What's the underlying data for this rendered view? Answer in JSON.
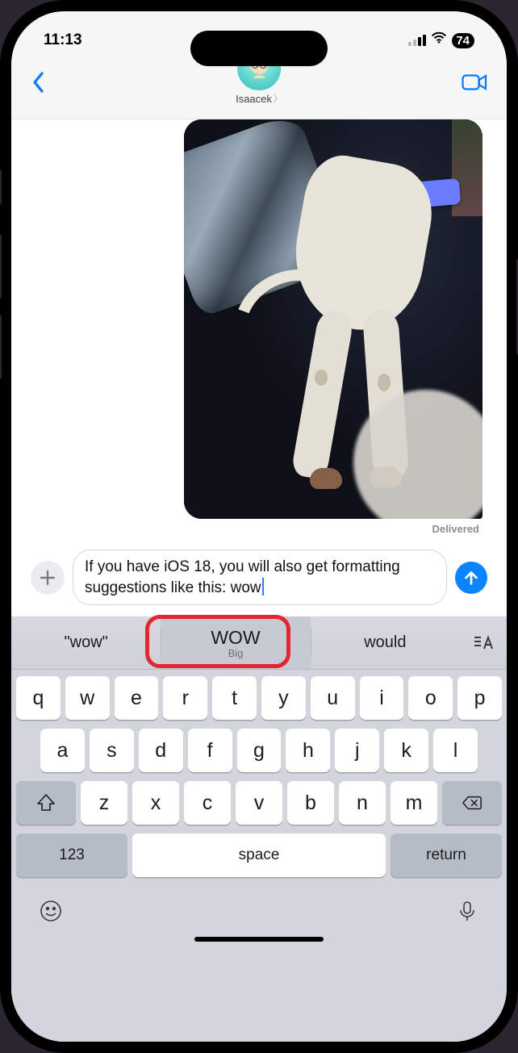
{
  "status": {
    "time": "11:13",
    "battery": "74"
  },
  "header": {
    "contact_name": "Isaacek"
  },
  "conversation": {
    "delivered_label": "Delivered"
  },
  "compose": {
    "text": "If you have iOS 18, you will also get formatting suggestions like this: wow"
  },
  "suggestions": {
    "left": "\"wow\"",
    "center_main": "WOW",
    "center_sub": "Big",
    "right": "would"
  },
  "keyboard": {
    "row1": [
      "q",
      "w",
      "e",
      "r",
      "t",
      "y",
      "u",
      "i",
      "o",
      "p"
    ],
    "row2": [
      "a",
      "s",
      "d",
      "f",
      "g",
      "h",
      "j",
      "k",
      "l"
    ],
    "row3": [
      "z",
      "x",
      "c",
      "v",
      "b",
      "n",
      "m"
    ],
    "num_label": "123",
    "space_label": "space",
    "return_label": "return"
  }
}
